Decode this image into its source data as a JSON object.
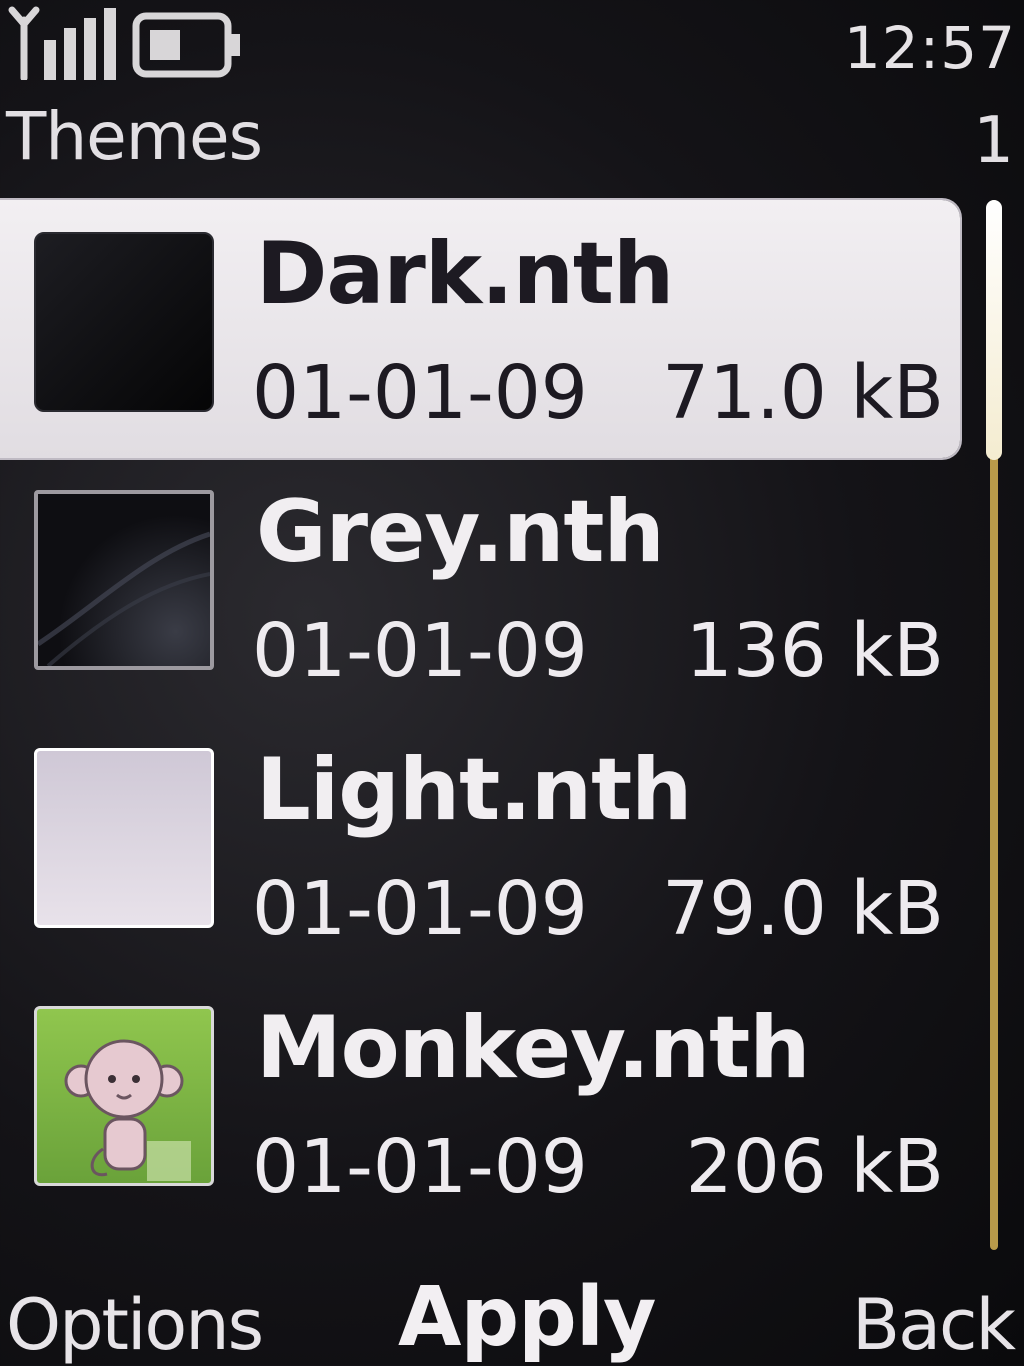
{
  "status_bar": {
    "time": "12:57"
  },
  "header": {
    "title": "Themes",
    "count": "1"
  },
  "themes": [
    {
      "name": "Dark.nth",
      "date": "01-01-09",
      "size": "71.0 kB",
      "selected": true
    },
    {
      "name": "Grey.nth",
      "date": "01-01-09",
      "size": "136 kB",
      "selected": false
    },
    {
      "name": "Light.nth",
      "date": "01-01-09",
      "size": "79.0 kB",
      "selected": false
    },
    {
      "name": "Monkey.nth",
      "date": "01-01-09",
      "size": "206 kB",
      "selected": false
    }
  ],
  "softkeys": {
    "left": "Options",
    "middle": "Apply",
    "right": "Back"
  },
  "colors": {
    "selection": "#ece8ec",
    "scrollbar": "#b89a4a",
    "background": "#141317"
  }
}
